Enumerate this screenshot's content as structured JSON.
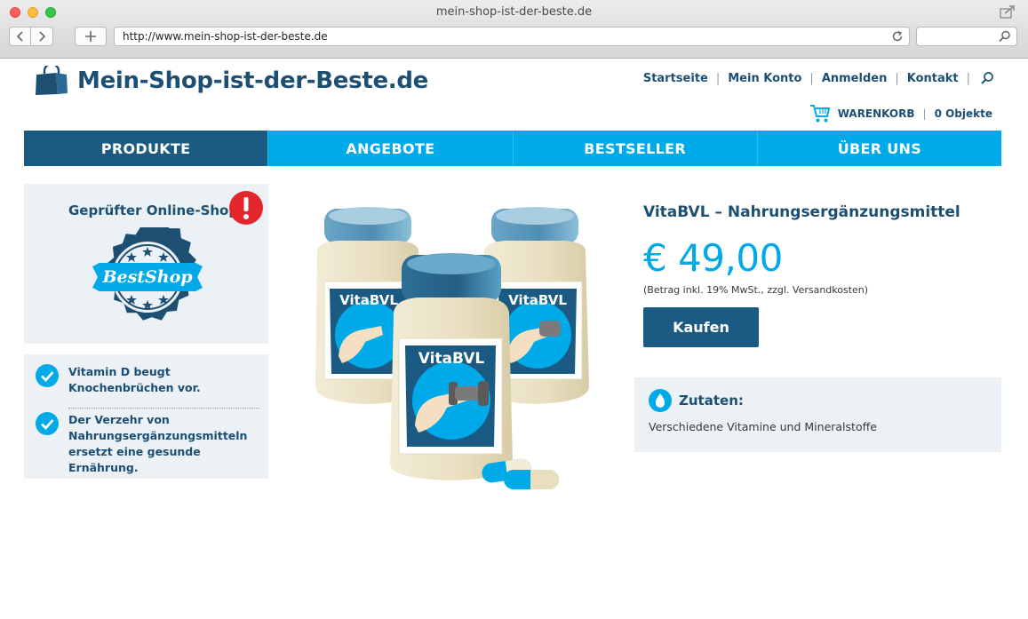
{
  "browser": {
    "window_title": "mein-shop-ist-der-beste.de",
    "url": "http://www.mein-shop-ist-der-beste.de",
    "search_placeholder": ""
  },
  "header": {
    "logo_text": "Mein-Shop-ist-der-Beste.de",
    "topnav": [
      "Startseite",
      "Mein Konto",
      "Anmelden",
      "Kontakt"
    ],
    "cart_label": "WARENKORB",
    "cart_count": "0 Objekte"
  },
  "mainnav": {
    "items": [
      "PRODUKTE",
      "ANGEBOTE",
      "BESTSELLER",
      "ÜBER UNS"
    ],
    "active": "PRODUKTE"
  },
  "sidebar": {
    "badge_title": "Geprüfter Online-Shop",
    "seal_text": "BestShop",
    "facts": [
      "Vitamin D beugt Knochenbrüchen vor.",
      "Der Verzehr von Nahrungsergänzungsmitteln ersetzt eine gesunde Ernährung."
    ]
  },
  "product": {
    "title": "VitaBVL – Nahrungsergänzungsmittel",
    "price": "€ 49,00",
    "tax_note": "(Betrag inkl. 19% MwSt., zzgl. Versandkosten)",
    "buy_label": "Kaufen",
    "jar_label": "VitaBVL",
    "ingredients_title": "Zutaten:",
    "ingredients_text": "Verschiedene Vitamine und Mineralstoffe"
  },
  "colors": {
    "brand_dark": "#1b5a82",
    "brand_light": "#00a9e8",
    "panel_bg": "#ebf1f5",
    "alert_red": "#e3262b"
  }
}
